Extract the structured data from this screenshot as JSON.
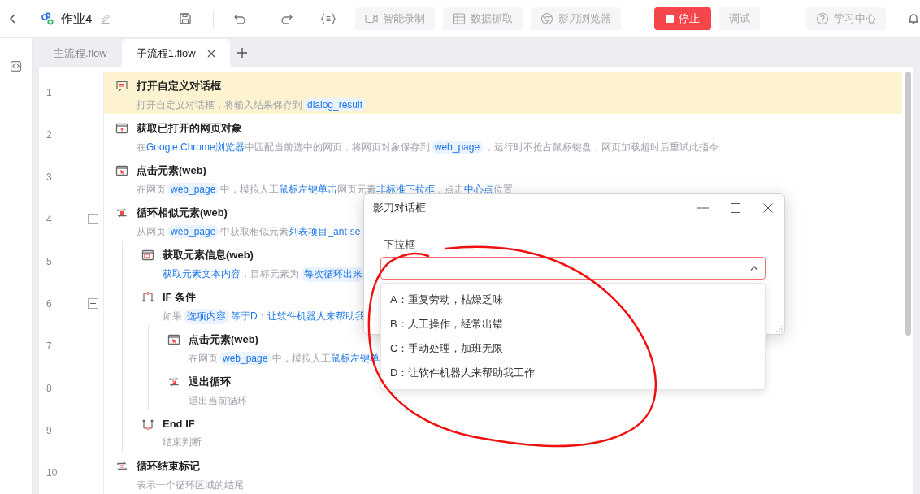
{
  "toolbar": {
    "project_name": "作业4",
    "buttons": [
      {
        "kind": "record",
        "label": "智能录制",
        "disabled": true
      },
      {
        "kind": "grab",
        "label": "数据抓取",
        "disabled": true
      },
      {
        "kind": "browser",
        "label": "影刀浏览器",
        "disabled": true
      },
      {
        "kind": "stop",
        "label": "停止",
        "disabled": false
      },
      {
        "kind": "debug",
        "label": "调试",
        "disabled": true
      }
    ],
    "help": "学习中心"
  },
  "tabs": [
    {
      "label": "主流程.flow",
      "selected": false
    },
    {
      "label": "子流程1.flow",
      "selected": true
    }
  ],
  "steps": [
    {
      "line": "1",
      "kind": "dialog",
      "title": "打开自定义对话框",
      "highlighted": true,
      "desc": [
        {
          "kind": "text",
          "text": "打开自定义对话框，将输入结果保存到"
        },
        {
          "kind": "var",
          "text": "dialog_result"
        }
      ]
    },
    {
      "line": "2",
      "kind": "browser",
      "title": "获取已打开的网页对象",
      "highlighted": false,
      "desc": [
        {
          "kind": "text",
          "text": "在"
        },
        {
          "kind": "link",
          "text": "Google Chrome浏览器"
        },
        {
          "kind": "text",
          "text": "中匹配当前选中的网页，将网页对象保存到"
        },
        {
          "kind": "var",
          "text": "web_page"
        },
        {
          "kind": "text",
          "text": "，运行时不抢占鼠标键盘，网页加载超时后重试此指令"
        }
      ]
    },
    {
      "line": "3",
      "kind": "click",
      "title": "点击元素(web)",
      "highlighted": false,
      "desc": [
        {
          "kind": "text",
          "text": "在网页"
        },
        {
          "kind": "var",
          "text": "web_page"
        },
        {
          "kind": "text",
          "text": "中，模拟人工"
        },
        {
          "kind": "link",
          "text": "鼠标左键单击"
        },
        {
          "kind": "text",
          "text": "网页元素"
        },
        {
          "kind": "link",
          "text": "非标准下拉框"
        },
        {
          "kind": "text",
          "text": "，点击"
        },
        {
          "kind": "link",
          "text": "中心点"
        },
        {
          "kind": "text",
          "text": "位置"
        }
      ]
    },
    {
      "line": "4",
      "kind": "loop",
      "title": "循环相似元素(web)",
      "highlighted": false,
      "expanded": true,
      "desc": [
        {
          "kind": "text",
          "text": "从网页"
        },
        {
          "kind": "var",
          "text": "web_page"
        },
        {
          "kind": "text",
          "text": "中获取相似元素"
        },
        {
          "kind": "link",
          "text": "列表项目_ant-se"
        }
      ],
      "children": [
        {
          "line": "5",
          "kind": "info",
          "title": "获取元素信息(web)",
          "highlighted": false,
          "desc": [
            {
              "kind": "link",
              "text": "获取元素文本内容"
            },
            {
              "kind": "text",
              "text": "，目标元素为"
            },
            {
              "kind": "var",
              "text": "每次循环出来"
            }
          ]
        },
        {
          "line": "6",
          "kind": "if",
          "title": "IF 条件",
          "highlighted": false,
          "expanded": true,
          "desc": [
            {
              "kind": "text",
              "text": "如果"
            },
            {
              "kind": "var",
              "text": "选项内容"
            },
            {
              "kind": "link",
              "text": "等于D：让软件机器人来帮助我"
            }
          ],
          "children": [
            {
              "line": "7",
              "kind": "click",
              "title": "点击元素(web)",
              "highlighted": false,
              "desc": [
                {
                  "kind": "text",
                  "text": "在网页"
                },
                {
                  "kind": "var",
                  "text": "web_page"
                },
                {
                  "kind": "text",
                  "text": "中，模拟人工"
                },
                {
                  "kind": "link",
                  "text": "鼠标左键单"
                }
              ]
            },
            {
              "line": "8",
              "kind": "break",
              "title": "退出循环",
              "highlighted": false,
              "desc": [
                {
                  "kind": "text",
                  "text": "退出当前循环"
                }
              ]
            }
          ]
        },
        {
          "line": "9",
          "kind": "endif",
          "title": "End IF",
          "highlighted": false,
          "desc": [
            {
              "kind": "text",
              "text": "结束判断"
            }
          ]
        }
      ]
    },
    {
      "line": "10",
      "kind": "endloop",
      "title": "循环结束标记",
      "highlighted": false,
      "desc": [
        {
          "kind": "text",
          "text": "表示一个循环区域的结尾"
        }
      ]
    }
  ],
  "dialog": {
    "title": "影刀对话框",
    "field_label": "下拉框",
    "expanded": true,
    "options": [
      {
        "label": "A：重复劳动，枯燥乏味",
        "selected": false
      },
      {
        "label": "B：人工操作，经常出错",
        "selected": false
      },
      {
        "label": "C：手动处理，加班无限",
        "selected": false
      },
      {
        "label": "D：让软件机器人来帮助我工作",
        "selected": false
      }
    ]
  }
}
